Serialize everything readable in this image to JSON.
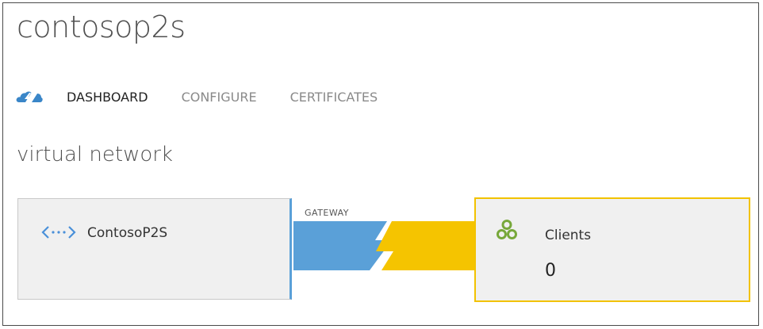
{
  "header": {
    "title": "contosop2s"
  },
  "tabs": {
    "icon": "cloud-quickstart-icon",
    "items": [
      {
        "label": "DASHBOARD",
        "active": true
      },
      {
        "label": "CONFIGURE",
        "active": false
      },
      {
        "label": "CERTIFICATES",
        "active": false
      }
    ]
  },
  "section": {
    "title": "virtual network"
  },
  "diagram": {
    "network": {
      "name": "ContosoP2S",
      "icon": "virtual-network-icon"
    },
    "gateway": {
      "label": "GATEWAY",
      "icon": "lightning-connection-icon"
    },
    "clients": {
      "label": "Clients",
      "count": "0",
      "icon": "clients-icon"
    }
  },
  "colors": {
    "blue": "#5aa0d8",
    "yellow": "#f5c400",
    "green": "#77a83a",
    "card_background": "#f0f0f0"
  }
}
